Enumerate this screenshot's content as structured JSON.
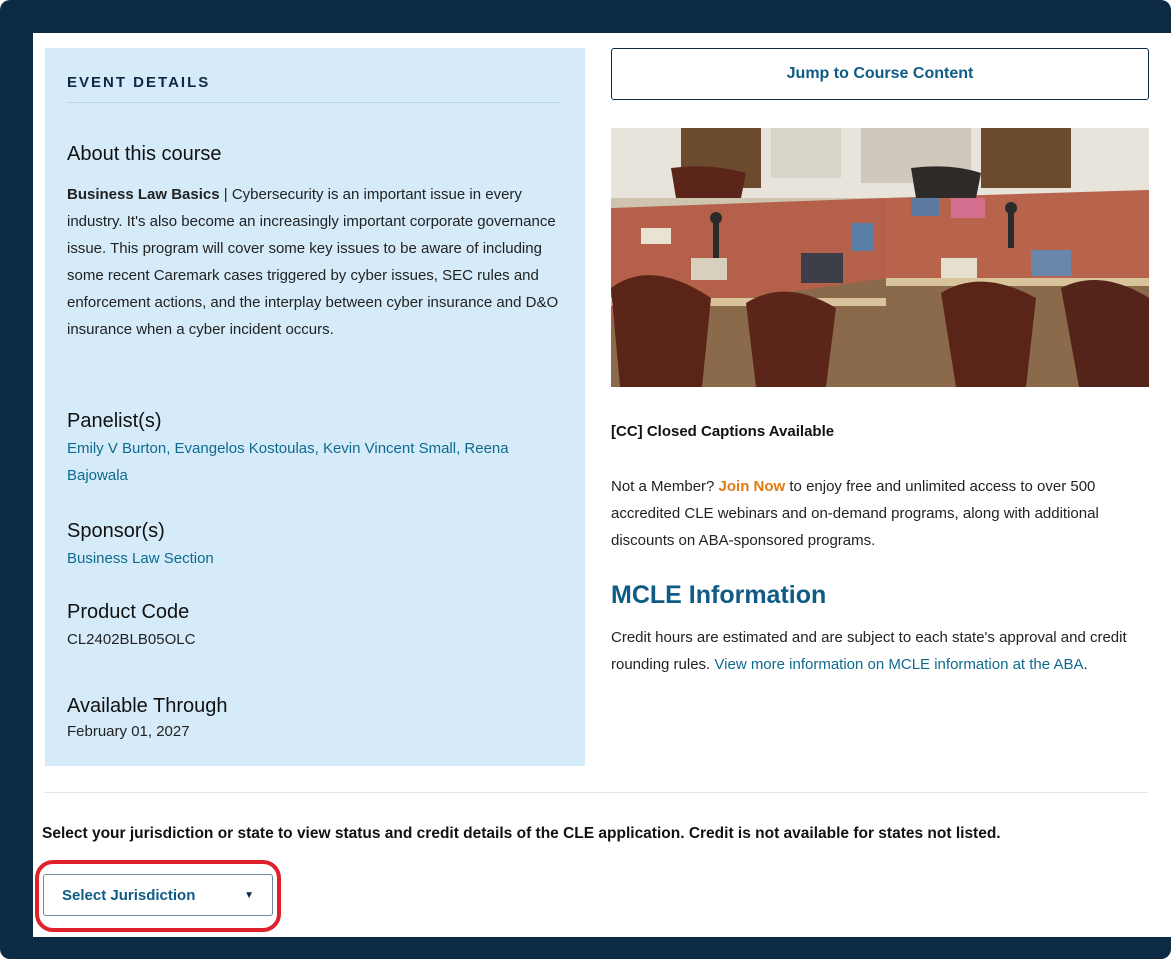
{
  "event_details": {
    "heading": "EVENT DETAILS",
    "about_title": "About this course",
    "about_bold": "Business Law Basics",
    "about_sep": " | ",
    "about_text": "Cybersecurity is an important issue in every industry. It's also become an increasingly important corporate governance issue. This program will cover some key issues to be aware of including some recent Caremark cases triggered by cyber issues, SEC rules and enforcement actions, and the interplay between cyber insurance and D&O insurance when a cyber incident occurs.",
    "panelists_title": "Panelist(s)",
    "panelists": "Emily V Burton, Evangelos Kostoulas, Kevin Vincent Small, Reena Bajowala",
    "sponsor_title": "Sponsor(s)",
    "sponsor": "Business Law Section",
    "product_code_title": "Product Code",
    "product_code": "CL2402BLB05OLC",
    "available_title": "Available Through",
    "available": "February 01, 2027"
  },
  "jump_button": "Jump to Course Content",
  "captions": "[CC] Closed Captions Available",
  "membership": {
    "prefix": "Not a Member? ",
    "join_link": "Join Now",
    "suffix": " to enjoy free and unlimited access to over 500 accredited CLE webinars and on-demand programs, along with additional discounts on ABA-sponsored programs."
  },
  "mcle": {
    "title": "MCLE Information",
    "text": "Credit hours are estimated and are subject to each state's approval and credit rounding rules. ",
    "link": "View more information on MCLE information at the ABA",
    "end": "."
  },
  "jurisdiction": {
    "instructions": "Select your jurisdiction or state to view status and credit details of the CLE application. Credit is not available for states not listed.",
    "select_label": "Select Jurisdiction"
  },
  "colors": {
    "frame": "#0d2a45",
    "details_bg": "#d6ebfa",
    "link": "#0f6a8f",
    "accent_orange": "#e07a10",
    "highlight": "#e0212b"
  }
}
